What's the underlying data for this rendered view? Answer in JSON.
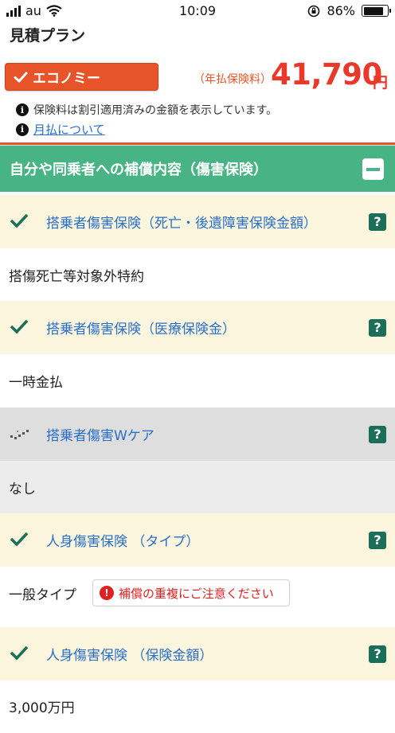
{
  "status_bar": {
    "carrier": "au",
    "time": "10:09",
    "battery_percent": "86%",
    "battery_level": 0.86
  },
  "header": {
    "title": "見積プラン",
    "plan_button_label": "エコノミー",
    "price_label": "（年払保険料）",
    "price_value": "41,790",
    "price_unit": "円",
    "info_text": "保険料は割引適用済みの金額を表示しています。",
    "monthly_link": "月払について"
  },
  "section": {
    "title": "自分や同乗者への補償内容（傷害保険）"
  },
  "items": [
    {
      "title": "搭乗者傷害保険（死亡・後遺障害保険金額）",
      "value": "搭傷死亡等対象外特約",
      "included": true
    },
    {
      "title": "搭乗者傷害保険（医療保険金）",
      "value": "一時金払",
      "included": true
    },
    {
      "title": "搭乗者傷害Wケア",
      "value": "なし",
      "included": false
    },
    {
      "title": "人身傷害保険 （タイプ）",
      "value": "一般タイプ",
      "included": true,
      "warning": "補償の重複にご注意ください"
    },
    {
      "title": "人身傷害保険 （保険金額）",
      "value": "3,000万円",
      "included": true
    }
  ],
  "help_label": "?",
  "info_glyph": "i",
  "warn_glyph": "!",
  "colors": {
    "accent_orange": "#e8542a",
    "price_red": "#e8392a",
    "section_green": "#48b384",
    "check_green": "#1b6e59",
    "link_blue": "#2a6fc9"
  }
}
